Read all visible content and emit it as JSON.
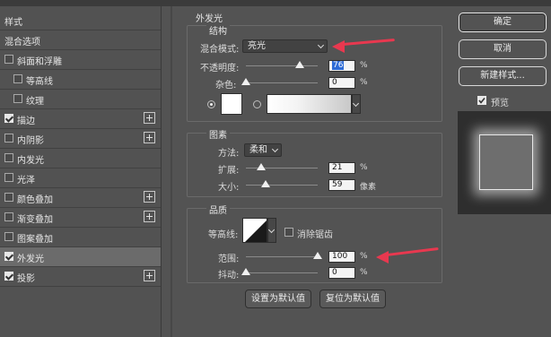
{
  "left_panel": {
    "items": [
      {
        "label": "样式",
        "checkbox": null,
        "plus": false,
        "selected": false,
        "indent": 0
      },
      {
        "label": "混合选项",
        "checkbox": null,
        "plus": false,
        "selected": false,
        "indent": 0
      },
      {
        "label": "斜面和浮雕",
        "checkbox": false,
        "plus": false,
        "selected": false,
        "indent": 0
      },
      {
        "label": "等高线",
        "checkbox": false,
        "plus": false,
        "selected": false,
        "indent": 1
      },
      {
        "label": "纹理",
        "checkbox": false,
        "plus": false,
        "selected": false,
        "indent": 1
      },
      {
        "label": "描边",
        "checkbox": true,
        "plus": true,
        "selected": false,
        "indent": 0
      },
      {
        "label": "内阴影",
        "checkbox": false,
        "plus": true,
        "selected": false,
        "indent": 0
      },
      {
        "label": "内发光",
        "checkbox": false,
        "plus": false,
        "selected": false,
        "indent": 0
      },
      {
        "label": "光泽",
        "checkbox": false,
        "plus": false,
        "selected": false,
        "indent": 0
      },
      {
        "label": "颜色叠加",
        "checkbox": false,
        "plus": true,
        "selected": false,
        "indent": 0
      },
      {
        "label": "渐变叠加",
        "checkbox": false,
        "plus": true,
        "selected": false,
        "indent": 0
      },
      {
        "label": "图案叠加",
        "checkbox": false,
        "plus": false,
        "selected": false,
        "indent": 0
      },
      {
        "label": "外发光",
        "checkbox": true,
        "plus": false,
        "selected": true,
        "indent": 0
      },
      {
        "label": "投影",
        "checkbox": true,
        "plus": true,
        "selected": false,
        "indent": 0
      }
    ]
  },
  "outer_glow": {
    "title": "外发光",
    "structure": {
      "title": "结构",
      "blend_mode_label": "混合模式:",
      "blend_mode_value": "亮光",
      "opacity_label": "不透明度:",
      "opacity_value": "76",
      "opacity_unit": "%",
      "opacity_fraction": 0.76,
      "noise_label": "杂色:",
      "noise_value": "0",
      "noise_unit": "%",
      "noise_fraction": 0.0,
      "color_mode": "solid",
      "gradient_label": ""
    },
    "elements": {
      "title": "图素",
      "method_label": "方法:",
      "method_value": "柔和",
      "spread_label": "扩展:",
      "spread_value": "21",
      "spread_unit": "%",
      "spread_fraction": 0.21,
      "size_label": "大小:",
      "size_value": "59",
      "size_unit": "像素",
      "size_fraction": 0.24
    },
    "quality": {
      "title": "品质",
      "contour_label": "等高线:",
      "antialias_label": "消除锯齿",
      "antialias_checked": false,
      "range_label": "范围:",
      "range_value": "100",
      "range_unit": "%",
      "range_fraction": 1.0,
      "jitter_label": "抖动:",
      "jitter_value": "0",
      "jitter_unit": "%",
      "jitter_fraction": 0.0
    },
    "buttons": {
      "set_default": "设置为默认值",
      "reset_default": "复位为默认值"
    }
  },
  "right_panel": {
    "ok": "确定",
    "cancel": "取消",
    "new_style": "新建样式...",
    "preview_label": "预览",
    "preview_checked": true
  },
  "colors": {
    "annotation_arrow": "#e8384f",
    "highlight": "#2d6bd6",
    "selected_row": "#6b6b6b"
  }
}
